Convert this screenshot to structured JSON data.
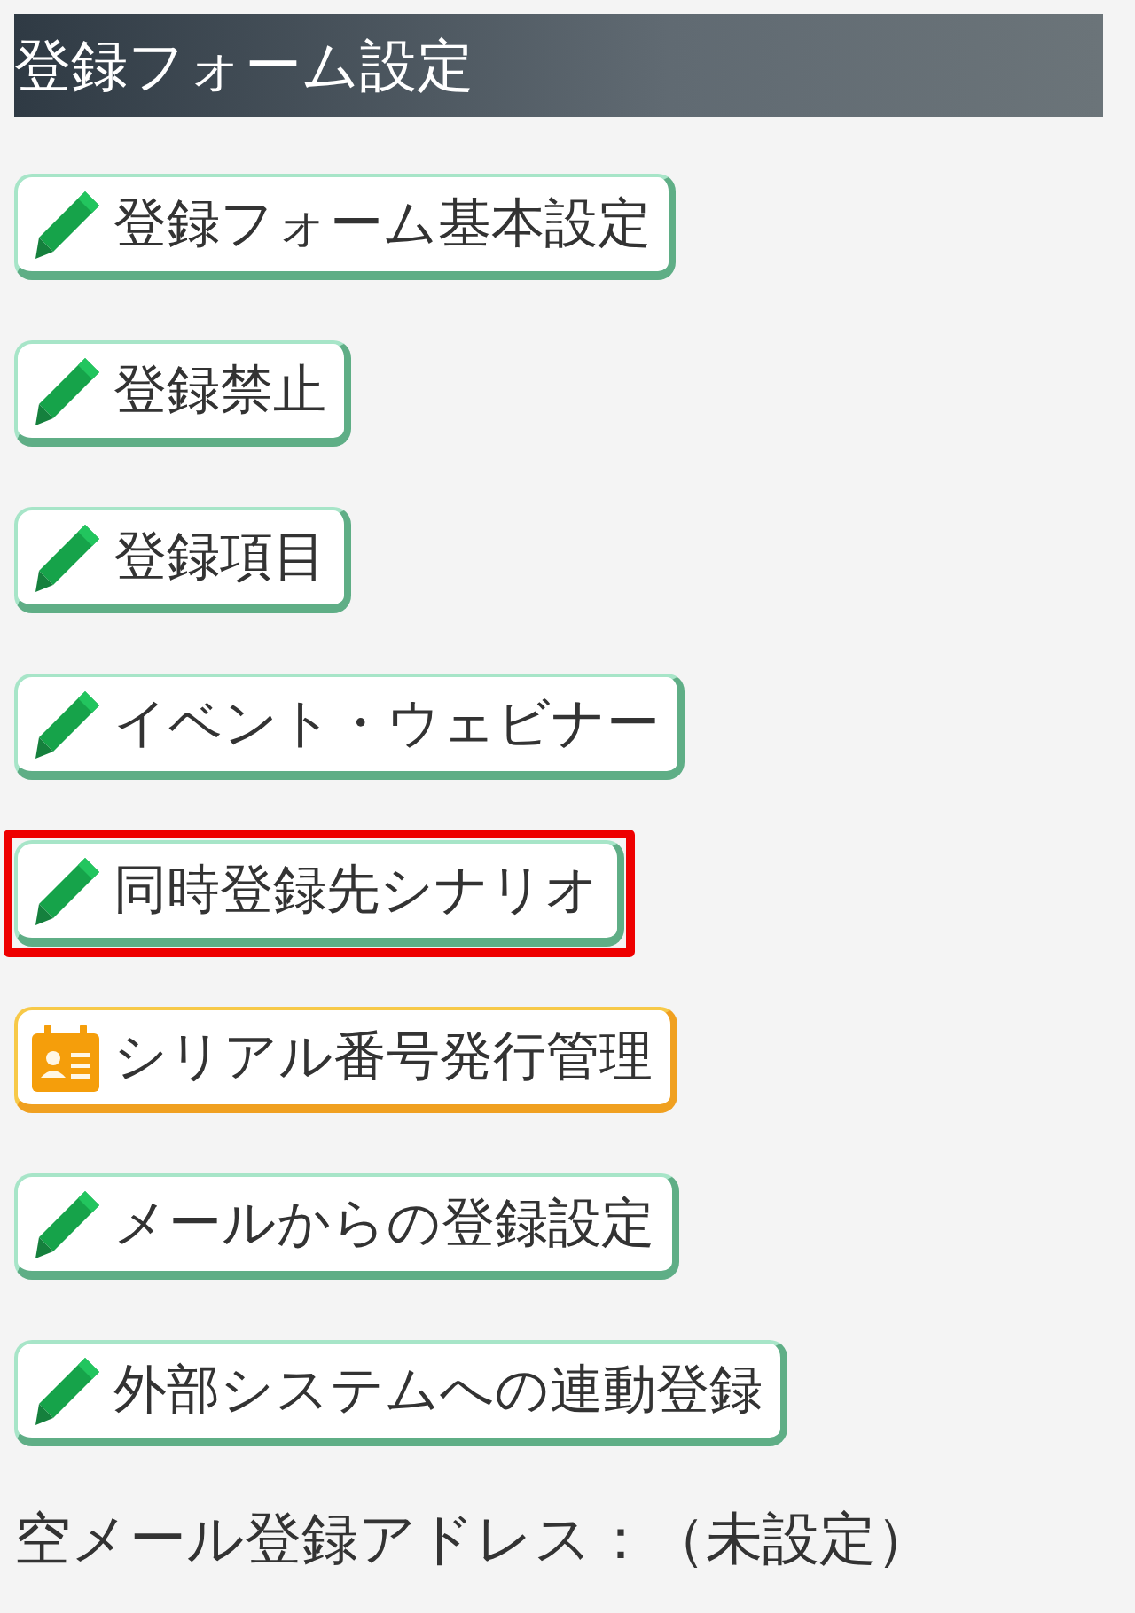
{
  "section": {
    "title": "登録フォーム設定"
  },
  "buttons": [
    {
      "label": "登録フォーム基本設定",
      "kind": "edit",
      "highlighted": false
    },
    {
      "label": "登録禁止",
      "kind": "edit",
      "highlighted": false
    },
    {
      "label": "登録項目",
      "kind": "edit",
      "highlighted": false
    },
    {
      "label": "イベント・ウェビナー",
      "kind": "edit",
      "highlighted": false
    },
    {
      "label": "同時登録先シナリオ",
      "kind": "edit",
      "highlighted": true
    },
    {
      "label": "シリアル番号発行管理",
      "kind": "serial",
      "highlighted": false
    },
    {
      "label": "メールからの登録設定",
      "kind": "edit",
      "highlighted": false
    },
    {
      "label": "外部システムへの連動登録",
      "kind": "edit",
      "highlighted": false
    }
  ],
  "footer": {
    "text": "空メール登録アドレス：（未設定）"
  }
}
